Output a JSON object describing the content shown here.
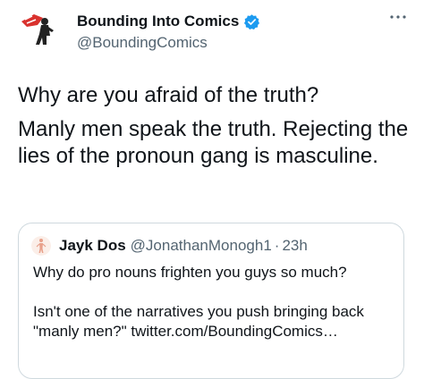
{
  "author": {
    "display_name": "Bounding Into Comics",
    "handle": "@BoundingComics",
    "avatar_icon": "bounding-logo-icon",
    "verified_icon": "verified-badge-icon"
  },
  "menu": {
    "icon": "more-options-icon"
  },
  "tweet": {
    "line1": "Why are you afraid of the truth?",
    "line2": "Manly men speak the truth. Rejecting the lies of the pronoun gang is masculine."
  },
  "quote": {
    "display_name": "Jayk Dos",
    "handle": "@JonathanMonogh1",
    "separator": "·",
    "time": "23h",
    "text1": "Why do pro nouns frighten you guys so much?",
    "text2": "Isn't one of the narratives you push bringing back \"manly men?\" twitter.com/BoundingComics…"
  },
  "colors": {
    "text": "#0f1419",
    "secondary": "#536471",
    "verified": "#1d9bf0",
    "logo_red": "#d9322e",
    "border": "#cfd9de"
  }
}
